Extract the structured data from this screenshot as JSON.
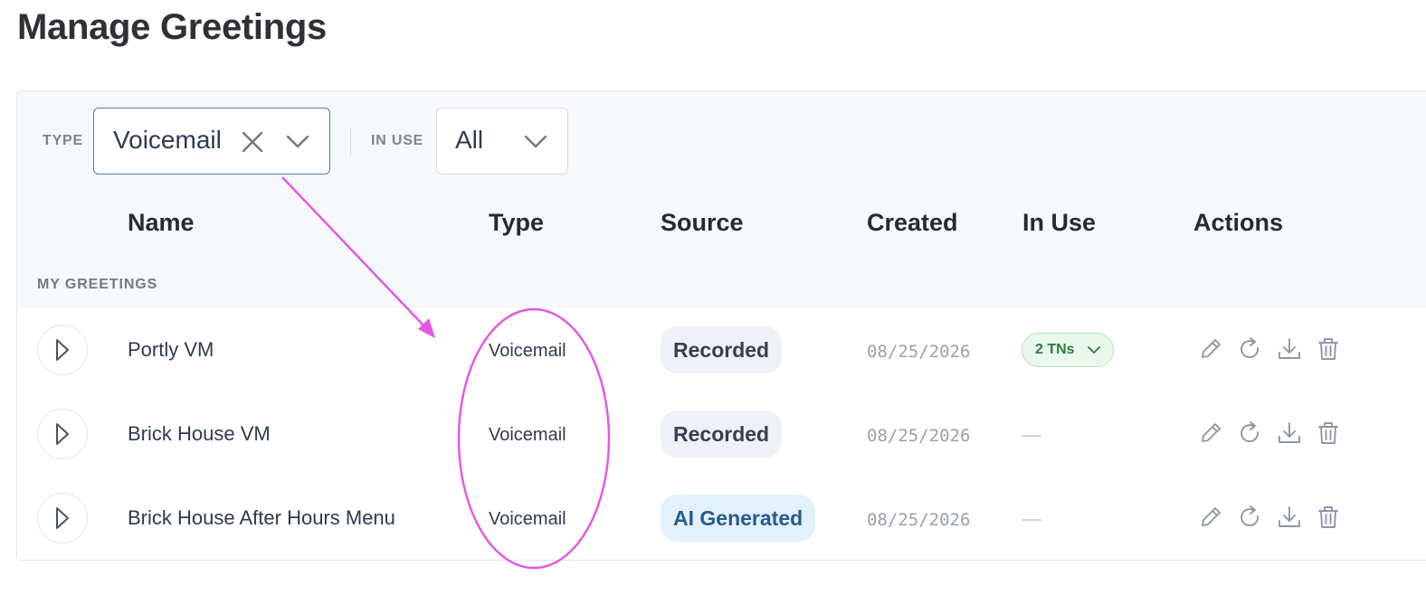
{
  "page": {
    "title": "Manage Greetings"
  },
  "filters": {
    "type": {
      "label": "TYPE",
      "value": "Voicemail"
    },
    "in_use": {
      "label": "IN USE",
      "value": "All"
    }
  },
  "table": {
    "headers": {
      "name": "Name",
      "type": "Type",
      "source": "Source",
      "created": "Created",
      "in_use": "In Use",
      "actions": "Actions"
    },
    "group_label": "MY GREETINGS",
    "rows": [
      {
        "name": "Portly VM",
        "type": "Voicemail",
        "source": "Recorded",
        "created": "08/25/2026",
        "in_use": "2 TNs"
      },
      {
        "name": "Brick House VM",
        "type": "Voicemail",
        "source": "Recorded",
        "created": "08/25/2026",
        "in_use": "—"
      },
      {
        "name": "Brick House After Hours Menu",
        "type": "Voicemail",
        "source": "AI Generated",
        "created": "08/25/2026",
        "in_use": "—"
      }
    ]
  },
  "icons": {
    "play": "play-icon",
    "clear": "close-icon",
    "dropdown": "chevron-down-icon",
    "edit": "pencil-icon",
    "regenerate": "refresh-icon",
    "download": "download-icon",
    "delete": "trash-icon"
  },
  "colors": {
    "annotation": "#e455e8",
    "in_use_badge": "#2e7d3a",
    "ai_badge_bg": "#e3f1fc",
    "recorded_badge_bg": "#eef1f6"
  }
}
